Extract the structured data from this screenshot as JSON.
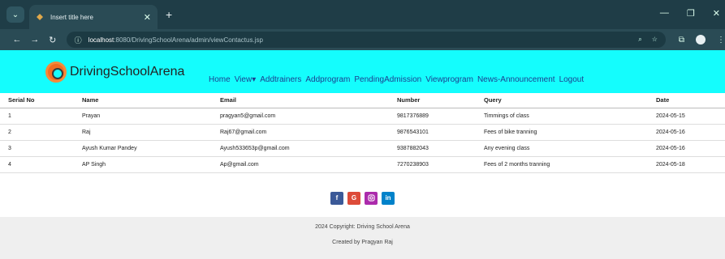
{
  "browser": {
    "tab_title": "Insert title here",
    "url_host": "localhost",
    "url_rest": ":8080/DrivingSchoolArena/admin/viewContactus.jsp"
  },
  "site": {
    "brand": "DrivingSchoolArena",
    "menu": [
      "Home",
      "View",
      "Addtrainers",
      "Addprogram",
      "PendingAdmission",
      "Viewprogram",
      "News-Announcement",
      "Logout"
    ]
  },
  "table": {
    "headers": [
      "Serial No",
      "Name",
      "Email",
      "Number",
      "Query",
      "Date"
    ],
    "rows": [
      [
        "1",
        "Prayan",
        "pragyan5@gmail.com",
        "9817376889",
        "Timmings of class",
        "2024-05-15"
      ],
      [
        "2",
        "Raj",
        "Raj67@gmail.com",
        "9876543101",
        "Fees of bike tranning",
        "2024-05-16"
      ],
      [
        "3",
        "Ayush Kumar Pandey",
        "Ayush533653p@gmail.com",
        "9387882043",
        "Any evening class",
        "2024-05-16"
      ],
      [
        "4",
        "AP Singh",
        "Ap@gmail.com",
        "7270238903",
        "Fees of 2 months tranning",
        "2024-05-18"
      ]
    ]
  },
  "footer": {
    "social": [
      "f",
      "G",
      "ig",
      "in"
    ],
    "copyright": "2024 Copyright: Driving School Arena",
    "credit": "Created by Pragyan Raj"
  }
}
